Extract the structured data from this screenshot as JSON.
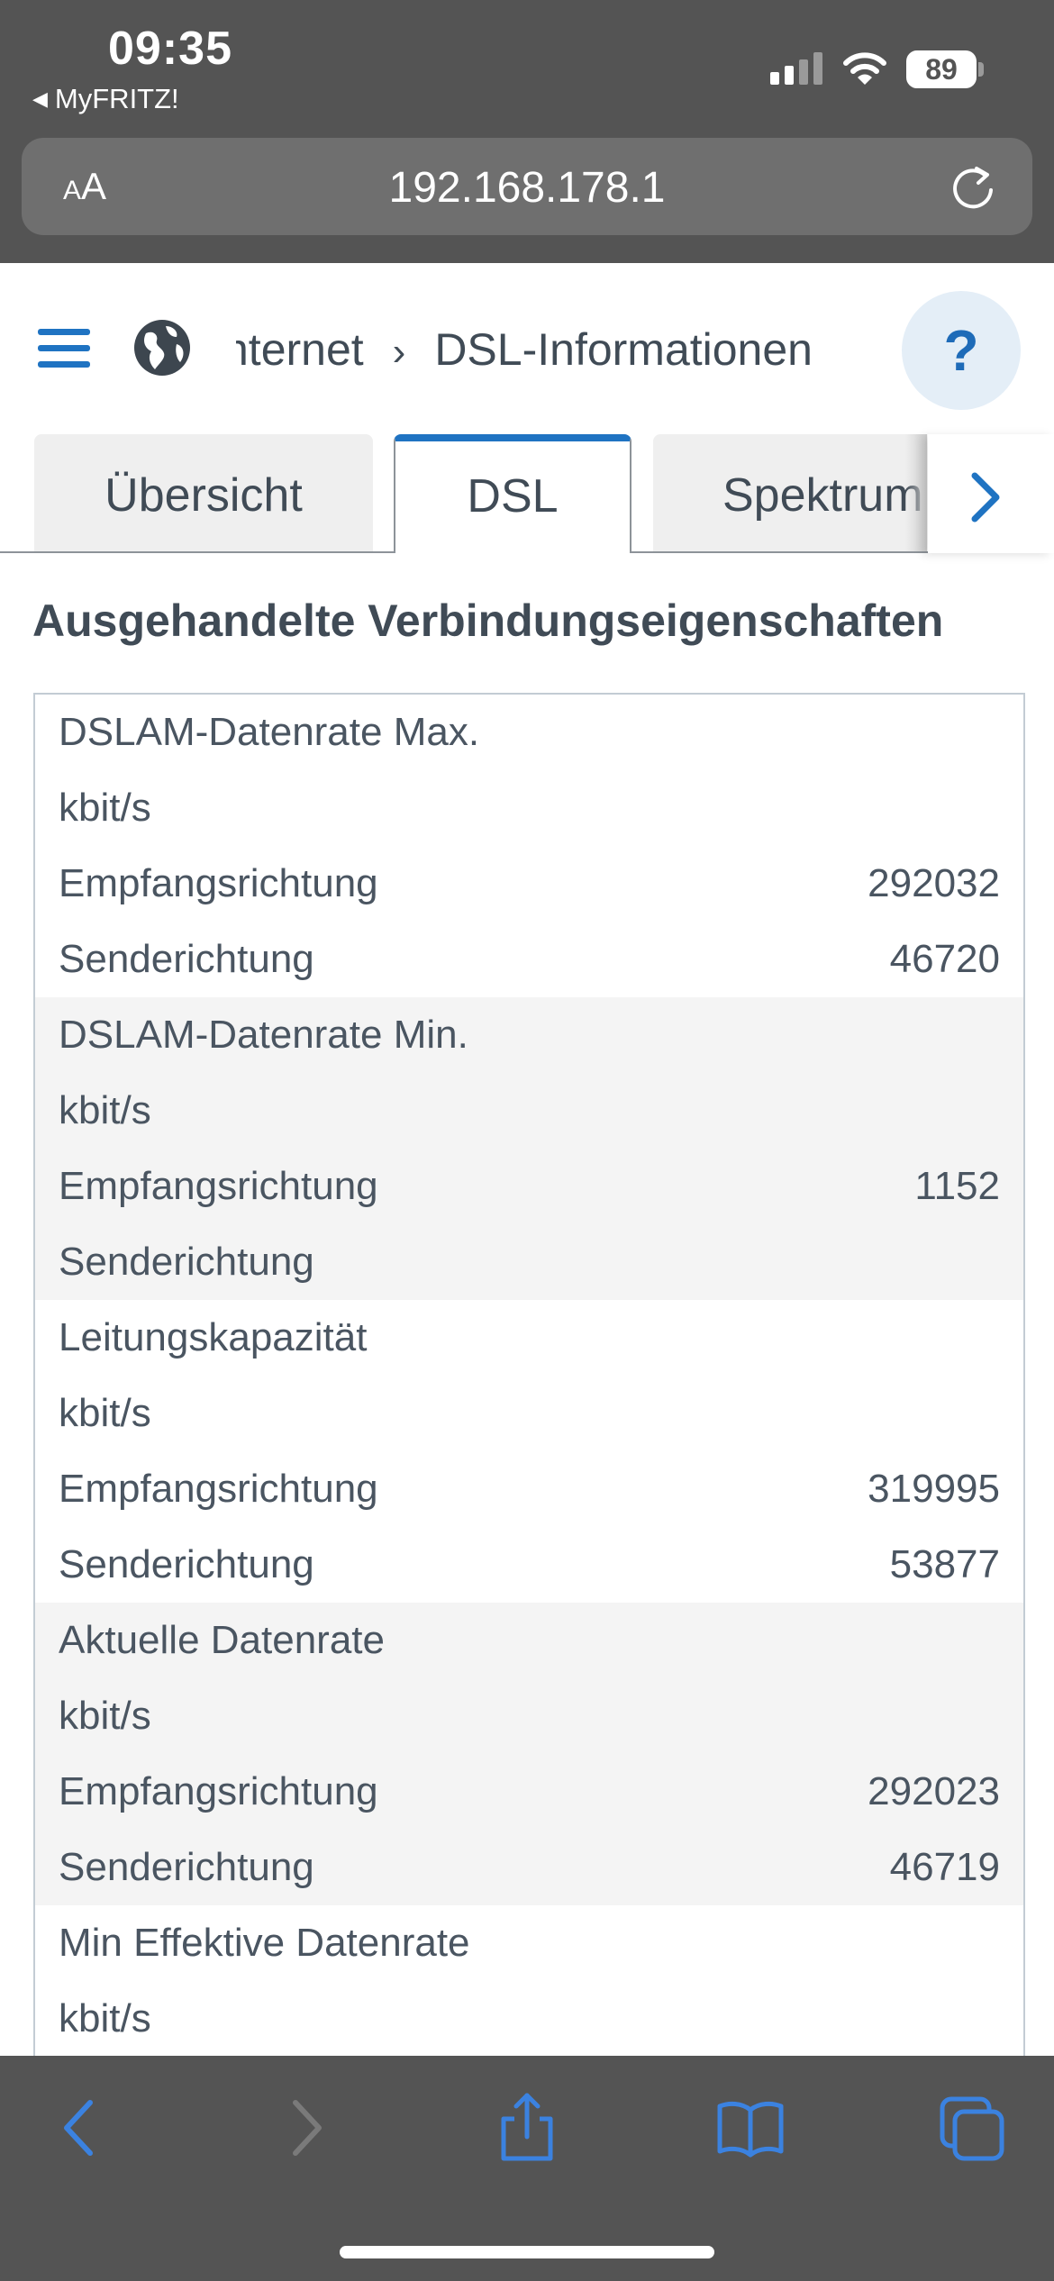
{
  "status_bar": {
    "time": "09:35",
    "back_app": "MyFRITZ!",
    "battery": "89"
  },
  "browser": {
    "aa_small": "A",
    "aa_big": "A",
    "url": "192.168.178.1"
  },
  "header": {
    "breadcrumb_parent": "nternet",
    "breadcrumb_separator": "›",
    "breadcrumb_current": "DSL-Informationen",
    "help_label": "?"
  },
  "tabs": [
    {
      "label": "Übersicht",
      "active": false
    },
    {
      "label": "DSL",
      "active": true
    },
    {
      "label": "Spektrum",
      "active": false
    }
  ],
  "section": {
    "title": "Ausgehandelte Verbindungseigenschaften"
  },
  "table": {
    "groups": [
      {
        "title": "DSLAM-Datenrate Max.",
        "unit": "kbit/s",
        "rows": [
          {
            "label": "Empfangsrichtung",
            "value": "292032"
          },
          {
            "label": "Senderichtung",
            "value": "46720"
          }
        ]
      },
      {
        "title": "DSLAM-Datenrate Min.",
        "unit": "kbit/s",
        "rows": [
          {
            "label": "Empfangsrichtung",
            "value": "1152"
          },
          {
            "label": "Senderichtung",
            "value": ""
          }
        ]
      },
      {
        "title": "Leitungskapazität",
        "unit": "kbit/s",
        "rows": [
          {
            "label": "Empfangsrichtung",
            "value": "319995"
          },
          {
            "label": "Senderichtung",
            "value": "53877"
          }
        ]
      },
      {
        "title": "Aktuelle Datenrate",
        "unit": "kbit/s",
        "rows": [
          {
            "label": "Empfangsrichtung",
            "value": "292023"
          },
          {
            "label": "Senderichtung",
            "value": "46719"
          }
        ]
      },
      {
        "title": "Min Effektive Datenrate",
        "unit": "kbit/s",
        "rows": []
      }
    ]
  },
  "colors": {
    "accent": "#1f73c2",
    "browser_chrome": "#545454",
    "text": "#4a5561",
    "ios_blue": "#3b82e0"
  },
  "icons": {
    "menu": "hamburger-menu-icon",
    "globe": "globe-icon",
    "next_tab": "chevron-right-icon",
    "reload": "reload-icon",
    "back": "chevron-left-icon",
    "forward": "chevron-right-icon",
    "share": "share-icon",
    "bookmarks": "book-icon",
    "tabs": "tabs-icon"
  }
}
